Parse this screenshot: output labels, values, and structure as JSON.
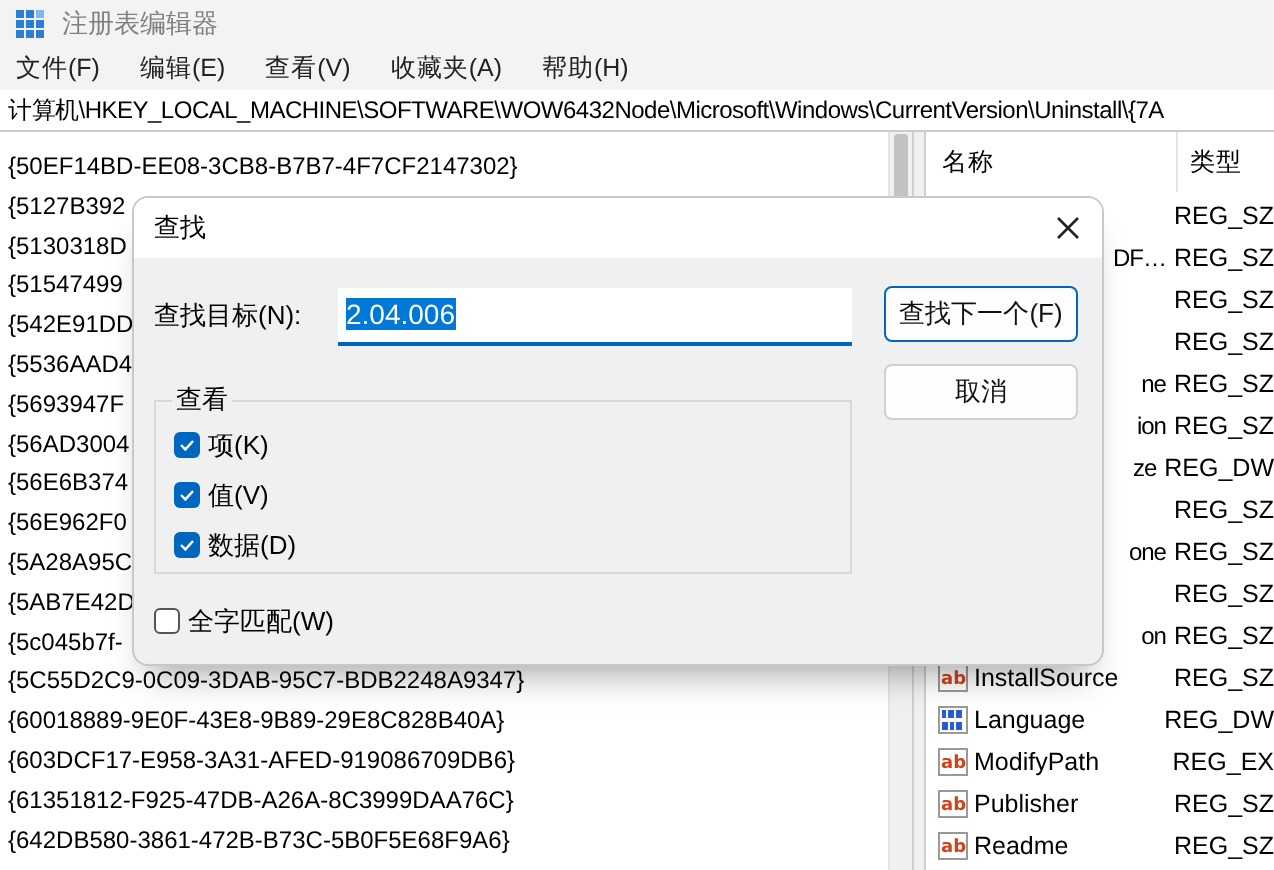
{
  "window": {
    "title": "注册表编辑器"
  },
  "menu": [
    "文件(F)",
    "编辑(E)",
    "查看(V)",
    "收藏夹(A)",
    "帮助(H)"
  ],
  "address": "计算机\\HKEY_LOCAL_MACHINE\\SOFTWARE\\WOW6432Node\\Microsoft\\Windows\\CurrentVersion\\Uninstall\\{7A",
  "tree": [
    "{50EF14BD-EE08-3CB8-B7B7-4F7CF2147302}",
    "{5127B392",
    "{5130318D",
    "{51547499",
    "{542E91DD",
    "{5536AAD4",
    "{5693947F",
    "{56AD3004",
    "{56E6B374",
    "{56E962F0",
    "{5A28A95C",
    "{5AB7E42D",
    "{5c045b7f-",
    "{5C55D2C9-0C09-3DAB-95C7-BDB2248A9347}",
    "{60018889-9E0F-43E8-9B89-29E8C828B40A}",
    "{603DCF17-E958-3A31-AFED-919086709DB6}",
    "{61351812-F925-47DB-A26A-8C3999DAA76C}",
    "{642DB580-3861-472B-B73C-5B0F5E68F9A6}"
  ],
  "values": {
    "columns": [
      "名称",
      "类型"
    ],
    "rows": [
      {
        "kind": "covered",
        "type": "REG_SZ"
      },
      {
        "kind": "covered",
        "name": "DF…",
        "type": "REG_SZ"
      },
      {
        "kind": "covered",
        "type": "REG_SZ"
      },
      {
        "kind": "covered",
        "type": "REG_SZ"
      },
      {
        "kind": "covered",
        "name": "ne",
        "type": "REG_SZ"
      },
      {
        "kind": "covered",
        "name": "ion",
        "type": "REG_SZ"
      },
      {
        "kind": "covered",
        "name": "ze",
        "type": "REG_DW"
      },
      {
        "kind": "covered",
        "type": "REG_SZ"
      },
      {
        "kind": "covered",
        "name": "one",
        "type": "REG_SZ"
      },
      {
        "kind": "covered",
        "type": "REG_SZ"
      },
      {
        "kind": "covered",
        "name": "on",
        "type": "REG_SZ"
      },
      {
        "kind": "string",
        "icon_label": "ab",
        "name": "InstallSource",
        "type": "REG_SZ"
      },
      {
        "kind": "number",
        "name": "Language",
        "type": "REG_DW"
      },
      {
        "kind": "string",
        "icon_label": "ab",
        "name": "ModifyPath",
        "type": "REG_EX"
      },
      {
        "kind": "string",
        "icon_label": "ab",
        "name": "Publisher",
        "type": "REG_SZ"
      },
      {
        "kind": "string",
        "icon_label": "ab",
        "name": "Readme",
        "type": "REG_SZ"
      }
    ]
  },
  "dialog": {
    "title": "查找",
    "find_label": "查找目标(N):",
    "find_value": "2.04.006",
    "value_selected": true,
    "group": "查看",
    "options": [
      {
        "label": "项(K)",
        "checked": true
      },
      {
        "label": "值(V)",
        "checked": true
      },
      {
        "label": "数据(D)",
        "checked": true
      }
    ],
    "whole_word": {
      "label": "全字匹配(W)",
      "checked": false
    },
    "buttons": [
      {
        "label": "查找下一个(F)",
        "default": true
      },
      {
        "label": "取消",
        "default": false
      }
    ]
  }
}
